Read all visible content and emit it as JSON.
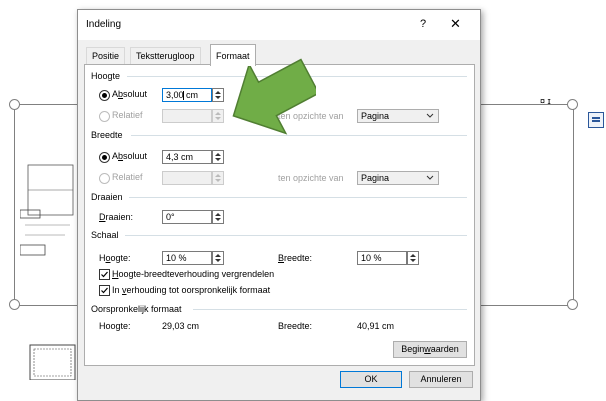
{
  "background": {
    "anchor_text": "¤ ɪ"
  },
  "dialog": {
    "title": "Indeling",
    "help_label": "?",
    "close_label": "✕",
    "tabs": [
      {
        "label": "Positie",
        "active": false
      },
      {
        "label": "Tekstterugloop",
        "active": false
      },
      {
        "label": "Formaat",
        "active": true
      }
    ],
    "hoogte": {
      "section": "Hoogte",
      "absoluut_pre": "A",
      "absoluut_ul": "b",
      "absoluut_post": "soluut",
      "absoluut_value": "3,00 cm",
      "relatief_label": "Relatief",
      "relatief_value": "",
      "opzichte_label": "ten opzichte van",
      "opzichte_value": "Pagina"
    },
    "breedte": {
      "section": "Breedte",
      "absoluut_pre": "A",
      "absoluut_ul": "b",
      "absoluut_post": "soluut",
      "absoluut_value": "4,3 cm",
      "relatief_label": "Relatief",
      "relatief_value": "",
      "opzichte_label": "ten opzichte van",
      "opzichte_value": "Pagina"
    },
    "draaien": {
      "section": "Draaien",
      "label_ul": "D",
      "label_post": "raaien:",
      "value": "0°"
    },
    "schaal": {
      "section": "Schaal",
      "hoogte_pre": "H",
      "hoogte_ul": "o",
      "hoogte_post": "ogte:",
      "hoogte_value": "10 %",
      "breedte_ul": "B",
      "breedte_post": "reedte:",
      "breedte_value": "10 %",
      "lock_ul": "H",
      "lock_post": "oogte-breedteverhouding vergrendelen",
      "lock_checked": true,
      "orig_pre": "In ",
      "orig_ul": "v",
      "orig_post": "erhouding tot oorspronkelijk formaat",
      "orig_checked": true
    },
    "oorspronkelijk": {
      "section": "Oorspronkelijk formaat",
      "hoogte_label": "Hoogte:",
      "hoogte_value": "29,03 cm",
      "breedte_label": "Breedte:",
      "breedte_value": "40,91 cm"
    },
    "reset_pre": "Begin",
    "reset_ul": "w",
    "reset_post": "aarden",
    "ok_label": "OK",
    "cancel_label": "Annuleren"
  },
  "colors": {
    "arrow": "#70ad47",
    "arrow_border": "#507e32",
    "accent": "#0078d7"
  }
}
